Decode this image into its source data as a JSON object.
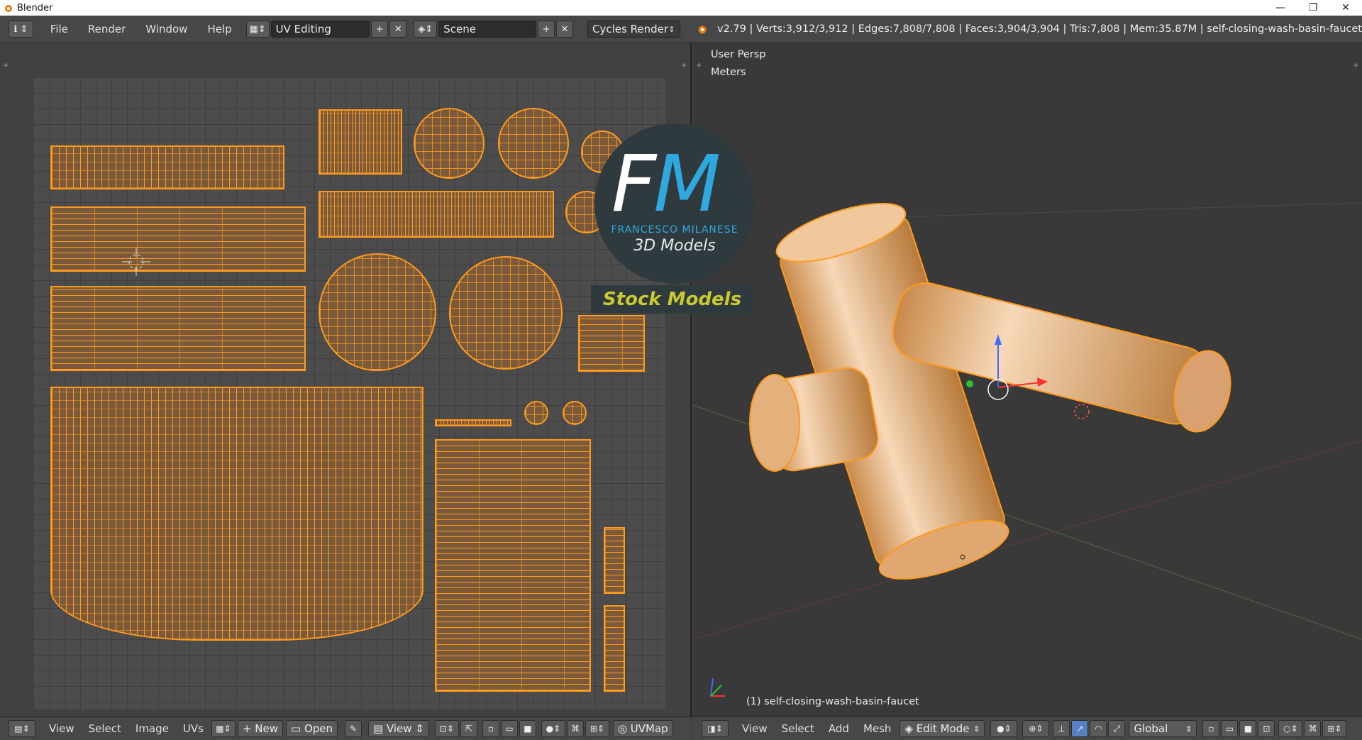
{
  "window": {
    "title": "Blender",
    "minimize": "—",
    "maximize": "❐",
    "close": "✕"
  },
  "menu": {
    "info_icon": "ℹ",
    "items": [
      "File",
      "Render",
      "Window",
      "Help"
    ]
  },
  "screen_layout": {
    "value": "UV Editing"
  },
  "scene": {
    "value": "Scene"
  },
  "render_engine": {
    "value": "Cycles Render"
  },
  "stats": "v2.79 | Verts:3,912/3,912 | Edges:7,808/7,808 | Faces:3,904/3,904 | Tris:7,808 | Mem:35.87M | self-closing-wash-basin-faucet",
  "viewport": {
    "view_name": "User Persp",
    "units": "Meters",
    "object_label": "(1) self-closing-wash-basin-faucet"
  },
  "watermark": {
    "letters_f": "F",
    "letters_m": "M",
    "name": "FRANCESCO MILANESE",
    "subtitle": "3D Models",
    "banner": "Stock Models"
  },
  "uv_header": {
    "view": "View",
    "select": "Select",
    "image": "Image",
    "uvs": "UVs",
    "new": "New",
    "open": "Open",
    "view2": "View",
    "uvmap": "UVMap"
  },
  "view3d_header": {
    "view": "View",
    "select": "Select",
    "add": "Add",
    "mesh": "Mesh",
    "mode": "Edit Mode",
    "orientation": "Global"
  },
  "colors": {
    "wire": "#ff9a1f",
    "accent": "#2fa8e0",
    "banner": "#c9c930"
  }
}
